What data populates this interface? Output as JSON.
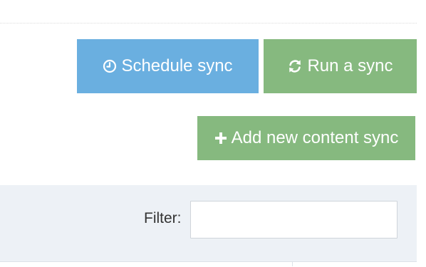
{
  "toolbar": {
    "schedule_label": "Schedule sync",
    "run_label": "Run a sync",
    "add_label": "Add new content sync"
  },
  "filter": {
    "label": "Filter:",
    "value": "",
    "placeholder": ""
  },
  "icons": {
    "schedule": "clock-icon",
    "run": "refresh-icon",
    "add": "plus-icon"
  },
  "colors": {
    "schedule_button": "#6aafe0",
    "run_button": "#86b97f",
    "add_button": "#86b97f",
    "filter_bar": "#edf1f6"
  }
}
